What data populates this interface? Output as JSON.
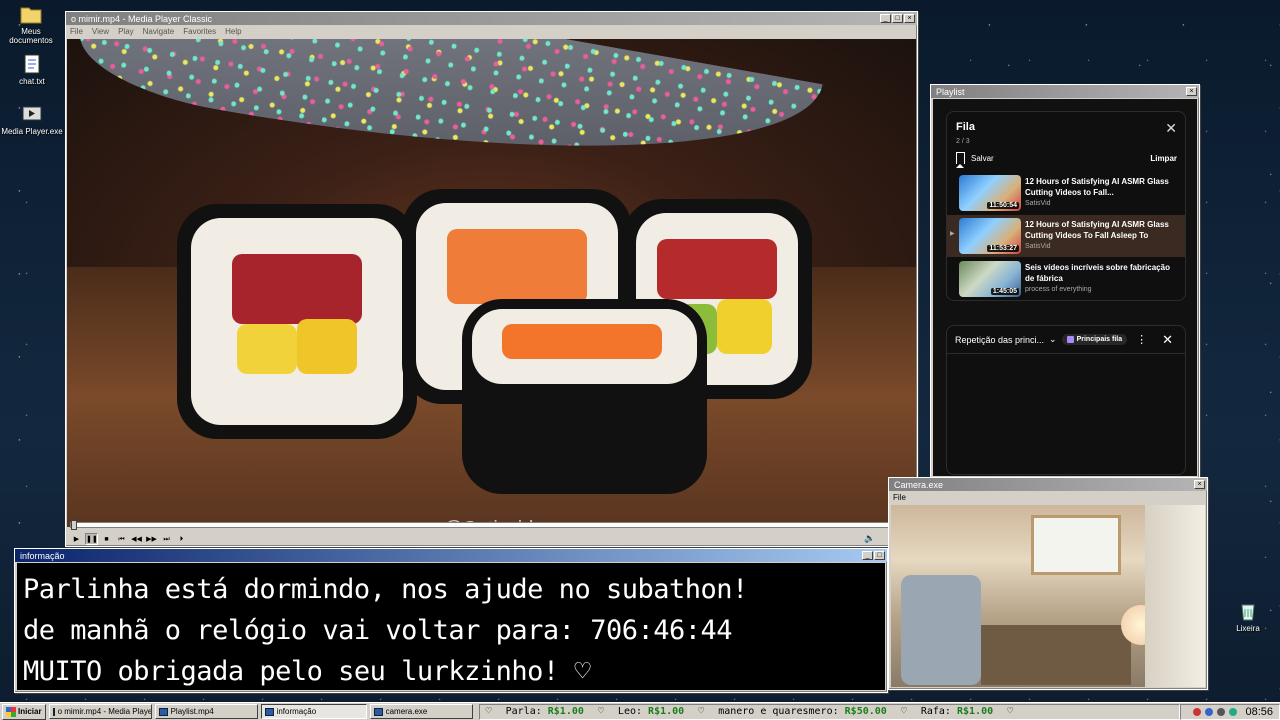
{
  "desktop": {
    "icons": [
      {
        "label": "Meus documentos"
      },
      {
        "label": "chat.txt"
      },
      {
        "label": "Media Player.exe"
      },
      {
        "label": "Lixeira"
      }
    ]
  },
  "media_player": {
    "title": "o mimir.mp4 - Media Player Classic",
    "menu": [
      "File",
      "View",
      "Play",
      "Navigate",
      "Favorites",
      "Help"
    ],
    "watermark": "@Satisvid",
    "controls": [
      "▶",
      "❚❚",
      "■",
      "⏮",
      "◀◀",
      "▶▶",
      "⏭",
      "⏵"
    ],
    "paused": true,
    "progress_fraction": 0.0
  },
  "playlist": {
    "title": "Playlist",
    "queue_title": "Fila",
    "queue_count": "2 / 3",
    "save_label": "Salvar",
    "clear_label": "Limpar",
    "items": [
      {
        "title": "12 Hours of Satisfying AI ASMR Glass Cutting Videos to Fall...",
        "channel": "SatisVid",
        "duration": "11:50:54",
        "current": false
      },
      {
        "title": "12 Hours of Satisfying AI ASMR Glass Cutting Videos To Fall Asleep To",
        "channel": "SatisVid",
        "duration": "11:53:27",
        "current": true
      },
      {
        "title": "Seis vídeos incríveis sobre fabricação de fábrica",
        "channel": "process of everything",
        "duration": "1:45:05",
        "current": false
      }
    ],
    "repeat_label": "Repetição das princi...",
    "chip_label": "Principais fila"
  },
  "info": {
    "title": "informação",
    "lines": [
      "Parlinha está dormindo, nos ajude no subathon!",
      "de manhã o relógio vai voltar para:  706:46:44",
      "MUITO obrigada pelo seu lurkzinho! ♡"
    ]
  },
  "camera": {
    "title": "Camera.exe",
    "menu_file": "File"
  },
  "taskbar": {
    "start_label": "Iniciar",
    "tasks": [
      {
        "label": "o mimir.mp4 - Media Player...",
        "active": false
      },
      {
        "label": "Playlist.mp4",
        "active": false
      },
      {
        "label": "informação",
        "active": true
      },
      {
        "label": "camera.exe",
        "active": false
      }
    ],
    "ticker": [
      {
        "name": "Parla:",
        "amount": "R$1.00"
      },
      {
        "name": "Leo:",
        "amount": "R$1.00"
      },
      {
        "name": "manero e quaresmero:",
        "amount": "R$50.00"
      },
      {
        "name": "Rafa:",
        "amount": "R$1.00"
      }
    ],
    "heart": "♡",
    "clock": "08:56"
  },
  "colors": {
    "active_title": "#0a246a",
    "ticker_amount": "#1a7f1a",
    "playlist_bg": "#111111"
  }
}
